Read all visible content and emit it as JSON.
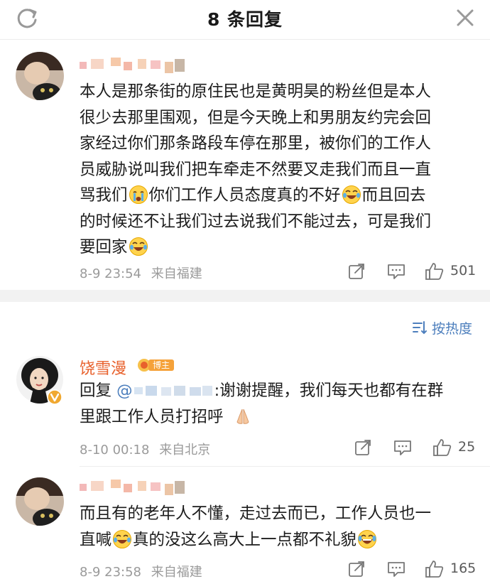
{
  "header": {
    "title": "8 条回复",
    "refresh_icon": "refresh-icon",
    "close_icon": "close-icon"
  },
  "root_comment": {
    "text_lines": [
      "本人是那条街的原住民也是黄明昊的粉丝但是本人",
      "很少去那里围观，但是今天晚上和男朋友约完会回",
      "家经过你们那条路段车停在那里，被你们的工作人",
      "员威胁说叫我们把车牵走不然要叉走我们而且一直",
      "骂我们",
      "你们工作人员态度真的不好",
      "而且回去",
      "的时候还不让我们过去说我们不能过去，可是我们",
      "要回家"
    ],
    "time": "8-9 23:54",
    "location": "来自福建",
    "likes": "501"
  },
  "sort": {
    "label": "按热度"
  },
  "replies": [
    {
      "name": "饶雪漫",
      "badge": "博主",
      "reply_prefix": "回复",
      "mention": "@",
      "text_line1": ":谢谢提醒，我们每天也都有在群",
      "text_line2": "里跟工作人员打招呼",
      "time": "8-10 00:18",
      "location": "来自北京",
      "likes": "25"
    },
    {
      "line1": "而且有的老年人不懂，走过去而已，工作人员也一",
      "line2a": "直喊",
      "line2b": "真的没这么高大上一点都不礼貌",
      "time": "8-9 23:58",
      "location": "来自福建",
      "likes": "165"
    }
  ],
  "colors": {
    "accent_blue": "#4d7fbd",
    "blogger_orange": "#e8612c",
    "meta_gray": "#9a9a9a"
  }
}
